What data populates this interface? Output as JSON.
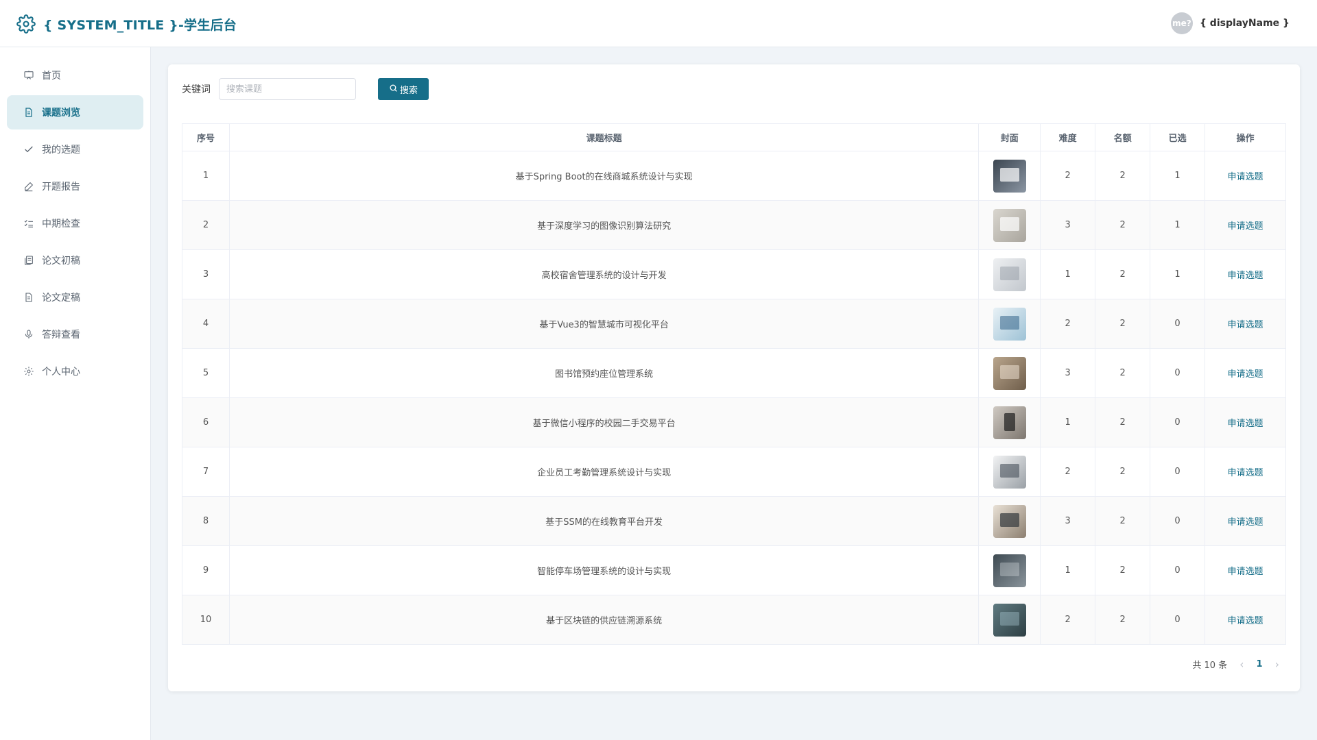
{
  "header": {
    "title": "{ SYSTEM_TITLE }-学生后台",
    "avatar_text": "me?",
    "display_name": "{ displayName }"
  },
  "sidebar": {
    "items": [
      {
        "label": "首页",
        "icon": "presentation-icon"
      },
      {
        "label": "课题浏览",
        "icon": "document-icon",
        "active": true
      },
      {
        "label": "我的选题",
        "icon": "check-icon"
      },
      {
        "label": "开题报告",
        "icon": "edit-pen-icon"
      },
      {
        "label": "中期检查",
        "icon": "checklist-icon"
      },
      {
        "label": "论文初稿",
        "icon": "copy-document-icon"
      },
      {
        "label": "论文定稿",
        "icon": "document-icon"
      },
      {
        "label": "答辩查看",
        "icon": "microphone-icon"
      },
      {
        "label": "个人中心",
        "icon": "gear-icon"
      }
    ]
  },
  "search": {
    "label": "关键词",
    "placeholder": "搜索课题",
    "value": "",
    "button_label": "搜索"
  },
  "table": {
    "headers": [
      "序号",
      "课题标题",
      "封面",
      "难度",
      "名额",
      "已选",
      "操作"
    ],
    "rows": [
      {
        "index": "1",
        "title": "基于Spring Boot的在线商城系统设计与实现",
        "difficulty": "2",
        "quota": "2",
        "selected": "1",
        "action": "申请选题"
      },
      {
        "index": "2",
        "title": "基于深度学习的图像识别算法研究",
        "difficulty": "3",
        "quota": "2",
        "selected": "1",
        "action": "申请选题"
      },
      {
        "index": "3",
        "title": "高校宿舍管理系统的设计与开发",
        "difficulty": "1",
        "quota": "2",
        "selected": "1",
        "action": "申请选题"
      },
      {
        "index": "4",
        "title": "基于Vue3的智慧城市可视化平台",
        "difficulty": "2",
        "quota": "2",
        "selected": "0",
        "action": "申请选题"
      },
      {
        "index": "5",
        "title": "图书馆预约座位管理系统",
        "difficulty": "3",
        "quota": "2",
        "selected": "0",
        "action": "申请选题"
      },
      {
        "index": "6",
        "title": "基于微信小程序的校园二手交易平台",
        "difficulty": "1",
        "quota": "2",
        "selected": "0",
        "action": "申请选题"
      },
      {
        "index": "7",
        "title": "企业员工考勤管理系统设计与实现",
        "difficulty": "2",
        "quota": "2",
        "selected": "0",
        "action": "申请选题"
      },
      {
        "index": "8",
        "title": "基于SSM的在线教育平台开发",
        "difficulty": "3",
        "quota": "2",
        "selected": "0",
        "action": "申请选题"
      },
      {
        "index": "9",
        "title": "智能停车场管理系统的设计与实现",
        "difficulty": "1",
        "quota": "2",
        "selected": "0",
        "action": "申请选题"
      },
      {
        "index": "10",
        "title": "基于区块链的供应链溯源系统",
        "difficulty": "2",
        "quota": "2",
        "selected": "0",
        "action": "申请选题"
      }
    ]
  },
  "pagination": {
    "total_text": "共 10 条",
    "current_page": "1",
    "prev_icon": "chevron-left-icon",
    "next_icon": "chevron-right-icon"
  },
  "colors": {
    "primary": "#166e89",
    "active_bg": "#dfeef2"
  }
}
